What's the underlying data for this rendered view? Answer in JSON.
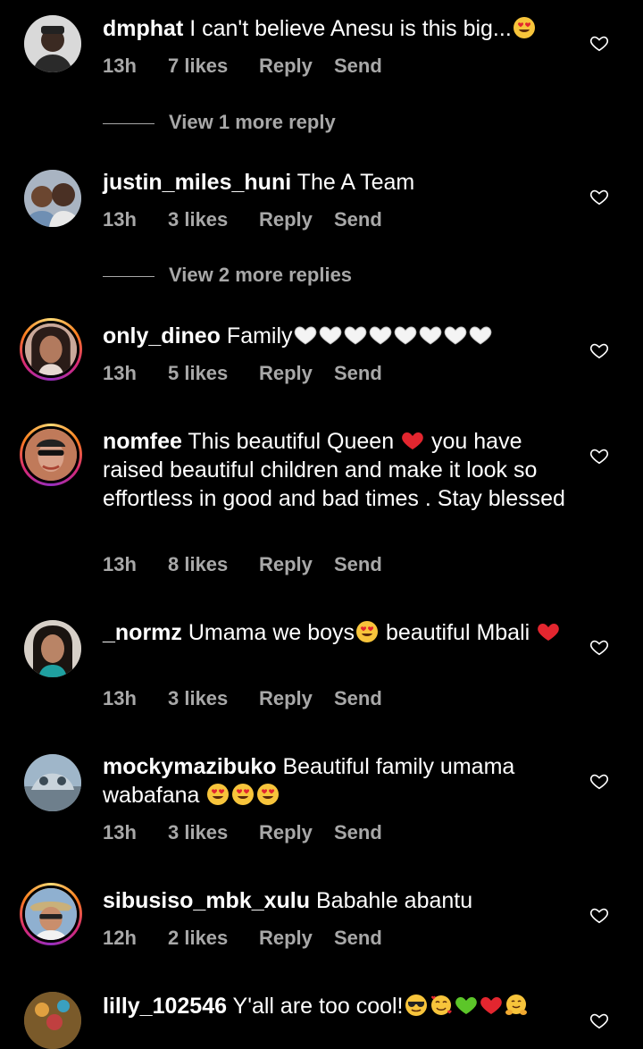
{
  "comments": [
    {
      "username": "dmphat",
      "text": "I can't believe Anesu is this big...",
      "emojis": [
        "heart-eyes"
      ],
      "time": "13h",
      "likes": "7 likes",
      "reply": "Reply",
      "send": "Send",
      "view_more": "View 1 more reply"
    },
    {
      "username": "justin_miles_huni",
      "text": "The A Team",
      "emojis": [],
      "time": "13h",
      "likes": "3 likes",
      "reply": "Reply",
      "send": "Send",
      "view_more": "View 2 more replies"
    },
    {
      "username": "only_dineo",
      "text": "Family",
      "emojis": [
        "white-heart",
        "white-heart",
        "white-heart",
        "white-heart",
        "white-heart",
        "white-heart",
        "white-heart",
        "white-heart"
      ],
      "time": "13h",
      "likes": "5 likes",
      "reply": "Reply",
      "send": "Send"
    },
    {
      "username": "nomfee",
      "text_before": "This beautiful Queen",
      "text_after": "you have raised beautiful children and make it look so effortless in good and bad times . Stay blessed",
      "emojis": [
        "red-heart"
      ],
      "time": "13h",
      "likes": "8 likes",
      "reply": "Reply",
      "send": "Send"
    },
    {
      "username": "_normz",
      "text_before": "Umama we boys",
      "text_after": "beautiful Mbali",
      "emojis": [
        "heart-eyes",
        "red-heart"
      ],
      "time": "13h",
      "likes": "3 likes",
      "reply": "Reply",
      "send": "Send"
    },
    {
      "username": "mockymazibuko",
      "text": "Beautiful family umama wabafana",
      "emojis": [
        "heart-eyes",
        "heart-eyes",
        "heart-eyes"
      ],
      "time": "13h",
      "likes": "3 likes",
      "reply": "Reply",
      "send": "Send"
    },
    {
      "username": "sibusiso_mbk_xulu",
      "text": "Babahle abantu",
      "emojis": [],
      "time": "12h",
      "likes": "2 likes",
      "reply": "Reply",
      "send": "Send"
    },
    {
      "username": "lilly_102546",
      "text": "Y'all are too cool!",
      "emojis": [
        "sunglasses",
        "smiling-hearts",
        "green-heart",
        "red-heart",
        "hugging"
      ]
    }
  ],
  "colors": {
    "background": "#000000",
    "text": "#ffffff",
    "secondary": "#a8a8a8"
  }
}
